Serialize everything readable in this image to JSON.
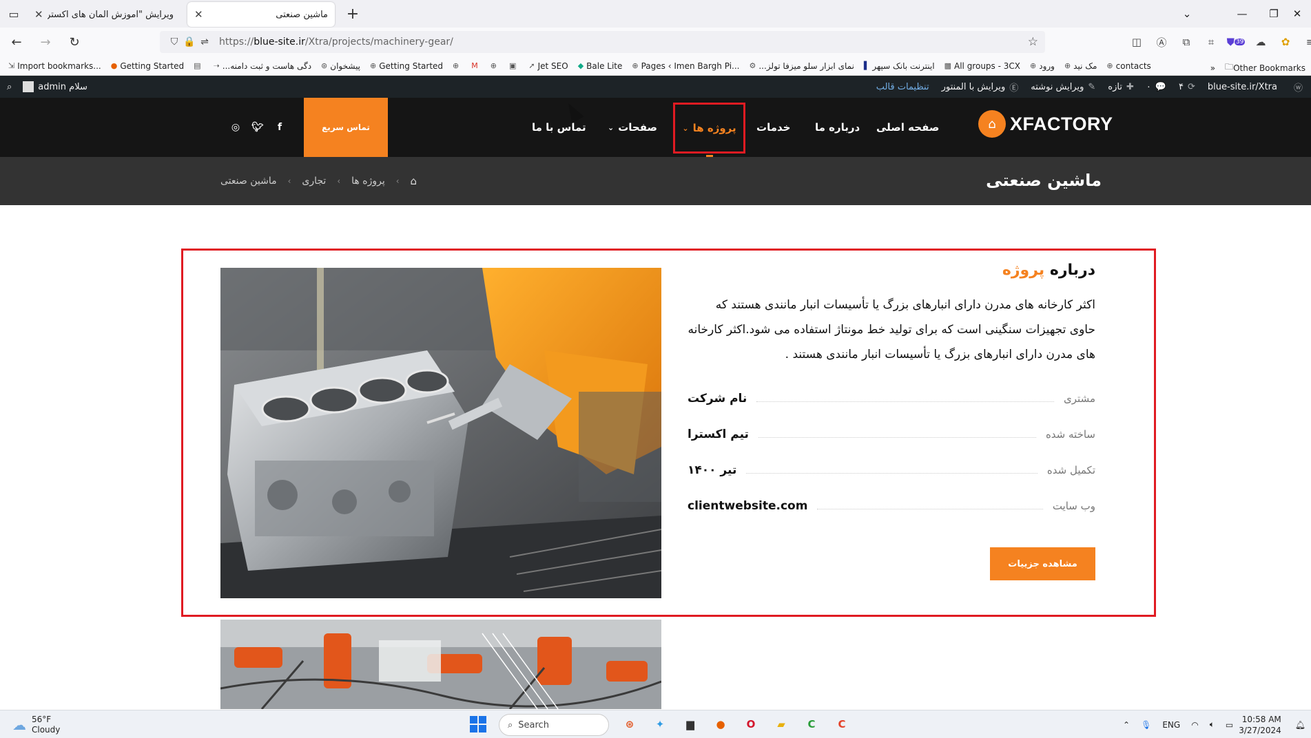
{
  "browser": {
    "tabs": [
      {
        "title": "ویرایش \"آموزش المان های اکسترا – ع",
        "active": false
      },
      {
        "title": "ماشین صنعتی",
        "active": true
      }
    ],
    "url_prefix": "https://",
    "url_host": "blue-site.ir",
    "url_path": "/Xtra/projects/machinery-gear/",
    "extension_badge": "39",
    "bookmarks": [
      "Import bookmarks...",
      "Getting Started",
      "...دگی هاست و ثبت دامنه",
      "پیشخوان",
      "Getting Started",
      "Jet SEO",
      "Bale Lite",
      "Pages ‹ Imen Bargh Pi...",
      "...نمای ابزار سلو میزفا تولز",
      "اینترنت بانک سپهر",
      "All groups - 3CX",
      "ورود",
      "مک نید",
      "contacts"
    ],
    "other_bookmarks": "Other Bookmarks"
  },
  "adminbar": {
    "site": "blue-site.ir/Xtra",
    "updates": "۴",
    "new": "تازه",
    "edit_post": "ویرایش نوشته",
    "edit_elementor": "ویرایش با المنتور",
    "theme_settings": "تنظیمات قالب",
    "greeting": "سلام admin"
  },
  "header": {
    "logo_text": "XFACTORY",
    "menu": {
      "home": "صفحه اصلی",
      "about": "درباره ما",
      "services": "خدمات",
      "projects": "پروژه ها",
      "pages": "صفحات",
      "contact": "تماس با ما"
    },
    "quick_contact": "تماس سریع"
  },
  "titlebar": {
    "title": "ماشین صنعتی",
    "breadcrumb": [
      "پروژه ها",
      "تجاری",
      "ماشین صنعتی"
    ]
  },
  "about": {
    "title_part1": "درباره",
    "title_part2": "پروژه",
    "description": "اکثر کارخانه های مدرن دارای انبارهای بزرگ یا تأسیسات انبار مانندی هستند که حاوی تجهیزات سنگینی است که برای تولید خط مونتاژ استفاده می شود.اکثر کارخانه های مدرن دارای انبارهای بزرگ یا تأسیسات انبار مانندی هستند .",
    "meta": [
      {
        "label": "مشتری",
        "value": "نام شرکت"
      },
      {
        "label": "ساخته شده",
        "value": "تیم اکسترا"
      },
      {
        "label": "تکمیل شده",
        "value": "تیر ۱۴۰۰"
      },
      {
        "label": "وب سایت",
        "value": "clientwebsite.com"
      }
    ],
    "details_button": "مشاهده جزییات"
  },
  "taskbar": {
    "temp": "56°F",
    "condition": "Cloudy",
    "search": "Search",
    "lang": "ENG",
    "time": "10:58 AM",
    "date": "3/27/2024"
  },
  "colors": {
    "accent": "#f58220",
    "header_bg": "#151515",
    "titlebar_bg": "#333333",
    "highlight": "#e01b22"
  }
}
